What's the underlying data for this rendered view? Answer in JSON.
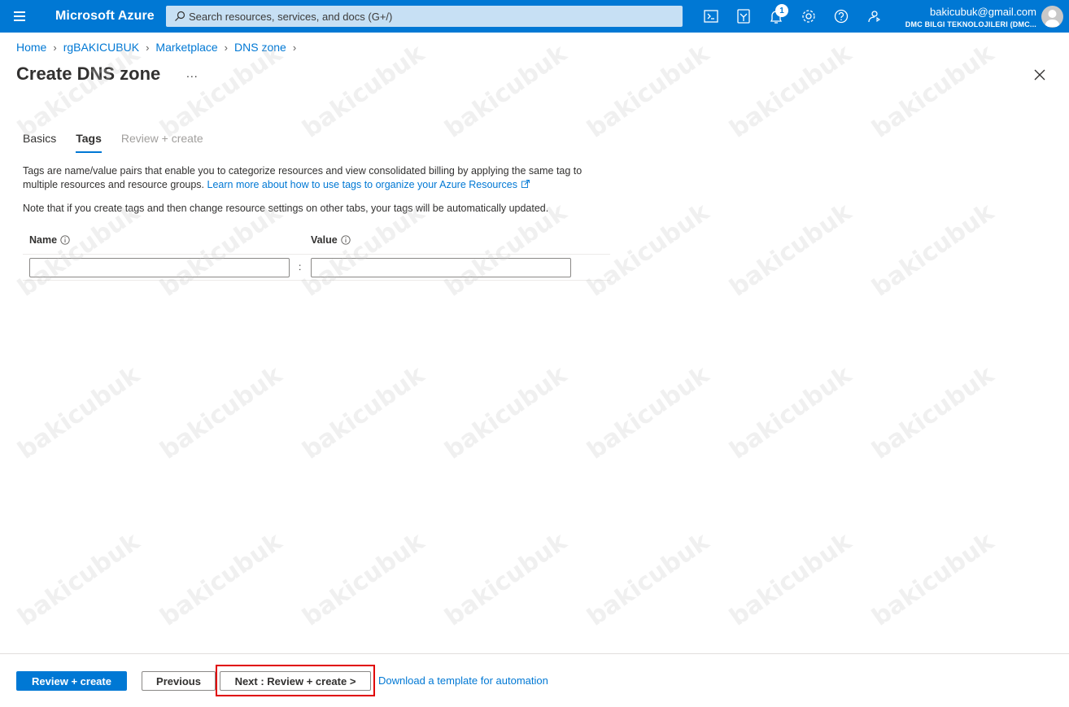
{
  "topbar": {
    "brand": "Microsoft Azure",
    "search_placeholder": "Search resources, services, and docs (G+/)",
    "notification_count": "1",
    "account_email": "bakicubuk@gmail.com",
    "account_org": "DMC BILGI TEKNOLOJILERI (DMC...",
    "icons": [
      "cloud-shell-icon",
      "directory-filter-icon",
      "notifications-icon",
      "settings-icon",
      "help-icon",
      "feedback-icon"
    ]
  },
  "breadcrumb": {
    "items": [
      "Home",
      "rgBAKICUBUK",
      "Marketplace",
      "DNS zone"
    ]
  },
  "page": {
    "title": "Create DNS zone",
    "more": "..."
  },
  "tabs": [
    {
      "label": "Basics",
      "state": "normal"
    },
    {
      "label": "Tags",
      "state": "active"
    },
    {
      "label": "Review + create",
      "state": "disabled"
    }
  ],
  "content": {
    "description": "Tags are name/value pairs that enable you to categorize resources and view consolidated billing by applying the same tag to multiple resources and resource groups.",
    "learn_more": "Learn more about how to use tags to organize your Azure Resources",
    "note": "Note that if you create tags and then change resource settings on other tabs, your tags will be automatically updated."
  },
  "tag_table": {
    "name_header": "Name",
    "value_header": "Value",
    "separator": ":",
    "name_value": "",
    "value_value": ""
  },
  "footer": {
    "review_create": "Review + create",
    "previous": "Previous",
    "next": "Next : Review + create >",
    "download": "Download a template for automation"
  },
  "watermark": "bakicubuk",
  "colors": {
    "accent": "#0078d4",
    "highlight": "#e00000"
  }
}
